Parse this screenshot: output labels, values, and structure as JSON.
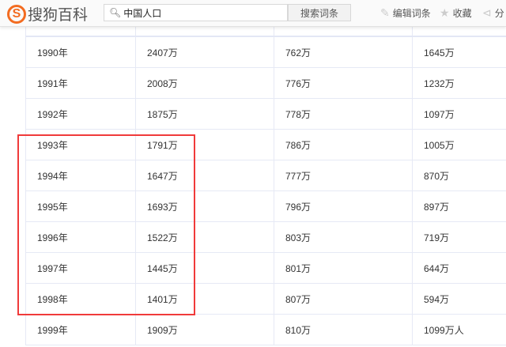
{
  "header": {
    "logo_letter": "S",
    "logo_text": "搜狗百科",
    "search_value": "中国人口",
    "search_button": "搜索词条",
    "edit": "编辑词条",
    "favorite": "收藏",
    "share": "分"
  },
  "rows": [
    [
      "1990年",
      "2407万",
      "762万",
      "1645万"
    ],
    [
      "1991年",
      "2008万",
      "776万",
      "1232万"
    ],
    [
      "1992年",
      "1875万",
      "778万",
      "1097万"
    ],
    [
      "1993年",
      "1791万",
      "786万",
      "1005万"
    ],
    [
      "1994年",
      "1647万",
      "777万",
      "870万"
    ],
    [
      "1995年",
      "1693万",
      "796万",
      "897万"
    ],
    [
      "1996年",
      "1522万",
      "803万",
      "719万"
    ],
    [
      "1997年",
      "1445万",
      "801万",
      "644万"
    ],
    [
      "1998年",
      "1401万",
      "807万",
      "594万"
    ],
    [
      "1999年",
      "1909万",
      "810万",
      "1099万人"
    ]
  ],
  "highlight": {
    "color": "#f03a3a",
    "rows": "1993年-1998年"
  }
}
